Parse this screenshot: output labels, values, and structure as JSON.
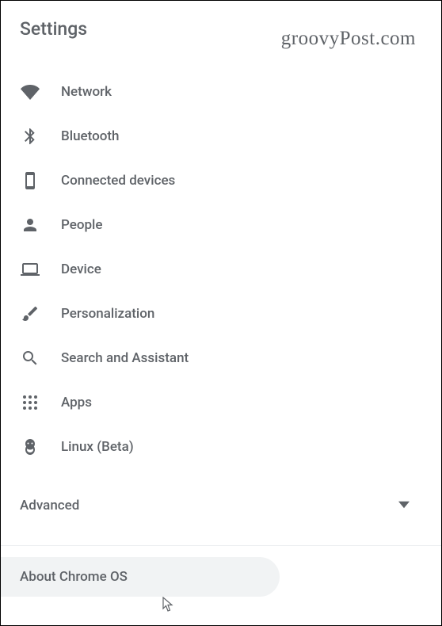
{
  "header": {
    "title": "Settings"
  },
  "watermark": "groovyPost.com",
  "nav": {
    "items": [
      {
        "id": "network",
        "label": "Network"
      },
      {
        "id": "bluetooth",
        "label": "Bluetooth"
      },
      {
        "id": "connected-devices",
        "label": "Connected devices"
      },
      {
        "id": "people",
        "label": "People"
      },
      {
        "id": "device",
        "label": "Device"
      },
      {
        "id": "personalization",
        "label": "Personalization"
      },
      {
        "id": "search-assistant",
        "label": "Search and Assistant"
      },
      {
        "id": "apps",
        "label": "Apps"
      },
      {
        "id": "linux",
        "label": "Linux (Beta)"
      }
    ]
  },
  "advanced": {
    "label": "Advanced"
  },
  "about": {
    "label": "About Chrome OS"
  }
}
